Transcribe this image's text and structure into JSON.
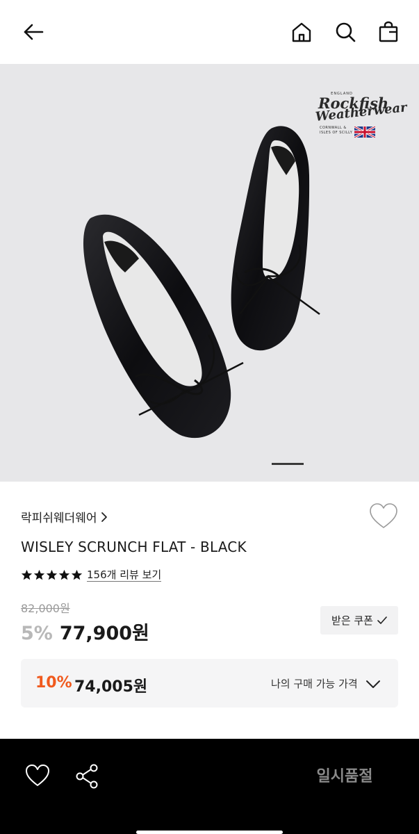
{
  "header": {
    "back_icon": "arrow-left-icon",
    "home_icon": "home-icon",
    "search_icon": "search-icon",
    "bag_icon": "shopping-bag-icon"
  },
  "hero": {
    "logo": {
      "line1": "Rockfish",
      "line2": "Weatherwear",
      "small": "ENGLAND",
      "location": "CORNWALL & ISLES OF SCILLY"
    },
    "active_slide": 1
  },
  "product": {
    "brand": "락피쉬웨더웨어",
    "title": "WISLEY SCRUNCH FLAT - BLACK",
    "rating_stars": 5,
    "review_text": "156개 리뷰 보기",
    "original_price": "82,000원",
    "discount": "5%",
    "price": "77,900원",
    "coupon_label": "받은 쿠폰"
  },
  "my_price": {
    "discount": "10%",
    "price": "74,005원",
    "label": "나의 구매 가능 가격"
  },
  "bottom_bar": {
    "status_label": "일시품절"
  },
  "colors": {
    "accent_orange": "#f05a1e",
    "hero_bg": "#e7e7e9",
    "bar_bg": "#000000"
  }
}
